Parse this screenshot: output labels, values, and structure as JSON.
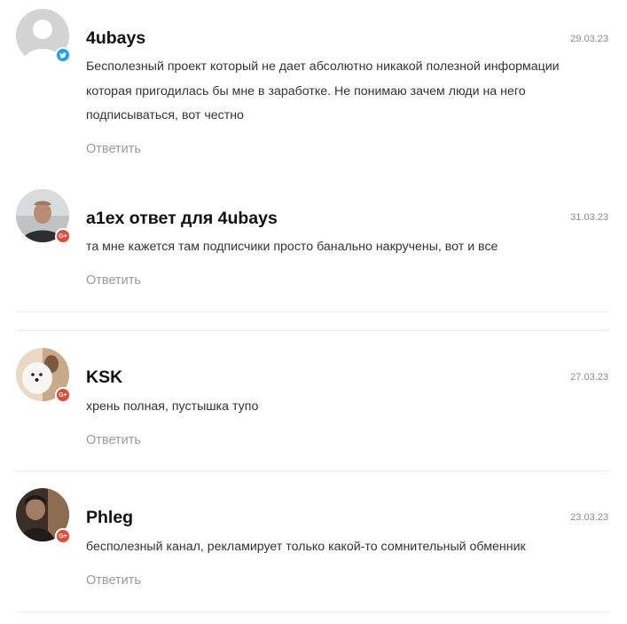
{
  "comments": [
    {
      "author": "4ubays",
      "date": "29.03.23",
      "text": "Бесполезный проект который не дает абсолютно никакой полезной информации которая пригодилась бы мне в заработке. Не понимаю зачем люди на него подписываться, вот честно",
      "reply_label": "Ответить",
      "network": "twitter-icon"
    },
    {
      "author": "a1ex ответ для 4ubays",
      "date": "31.03.23",
      "text": "та мне кажется там подписчики просто банально накручены, вот и все",
      "reply_label": "Ответить",
      "network": "google-plus-icon"
    },
    {
      "author": "KSK",
      "date": "27.03.23",
      "text": "хрень полная, пустышка тупо",
      "reply_label": "Ответить",
      "network": "google-plus-icon"
    },
    {
      "author": "Phleg",
      "date": "23.03.23",
      "text": "бесполезный канал, рекламирует только какой-то сомнительный обменник",
      "reply_label": "Ответить",
      "network": "google-plus-icon"
    }
  ],
  "colors": {
    "twitter": "#1da1f2",
    "google_plus": "#dd4b39",
    "reply": "#9a9a9a",
    "date": "#8a8a8a"
  }
}
